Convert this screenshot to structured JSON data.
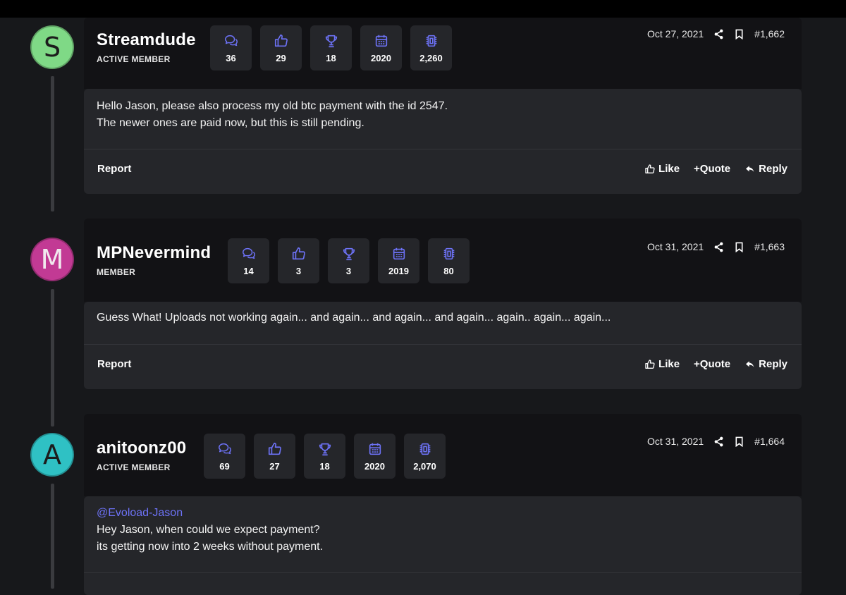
{
  "theme": {
    "accent": "#6d72f6",
    "background": "#17181b",
    "card": "#25262a",
    "header": "#121215"
  },
  "stat_icons": [
    "messages-icon",
    "thumbs-up-icon",
    "trophy-icon",
    "calendar-icon",
    "chip-icon"
  ],
  "posts": [
    {
      "avatar_letter": "S",
      "avatar_color": "#7fd986",
      "username": "Streamdude",
      "role": "ACTIVE MEMBER",
      "stats": [
        "36",
        "29",
        "18",
        "2020",
        "2,260"
      ],
      "date": "Oct 27, 2021",
      "post_number": "#1,662",
      "mention": "",
      "message_lines": [
        "Hello Jason, please also process my old btc payment with the id 2547.",
        "The newer ones are paid now, but this is still pending."
      ],
      "report_label": "Report",
      "like_label": "Like",
      "quote_label": "+Quote",
      "reply_label": "Reply"
    },
    {
      "avatar_letter": "M",
      "avatar_color": "#c23a94",
      "username": "MPNevermind",
      "role": "MEMBER",
      "stats": [
        "14",
        "3",
        "3",
        "2019",
        "80"
      ],
      "date": "Oct 31, 2021",
      "post_number": "#1,663",
      "mention": "",
      "message_lines": [
        "Guess What! Uploads not working again... and again... and again... and again... again.. again... again..."
      ],
      "report_label": "Report",
      "like_label": "Like",
      "quote_label": "+Quote",
      "reply_label": "Reply"
    },
    {
      "avatar_letter": "A",
      "avatar_color": "#2fc1c4",
      "username": "anitoonz00",
      "role": "ACTIVE MEMBER",
      "stats": [
        "69",
        "27",
        "18",
        "2020",
        "2,070"
      ],
      "date": "Oct 31, 2021",
      "post_number": "#1,664",
      "mention": "@Evoload-Jason",
      "message_lines": [
        "Hey Jason, when could we expect payment?",
        "its getting now into 2 weeks without payment."
      ],
      "report_label": "",
      "like_label": "",
      "quote_label": "",
      "reply_label": ""
    }
  ]
}
